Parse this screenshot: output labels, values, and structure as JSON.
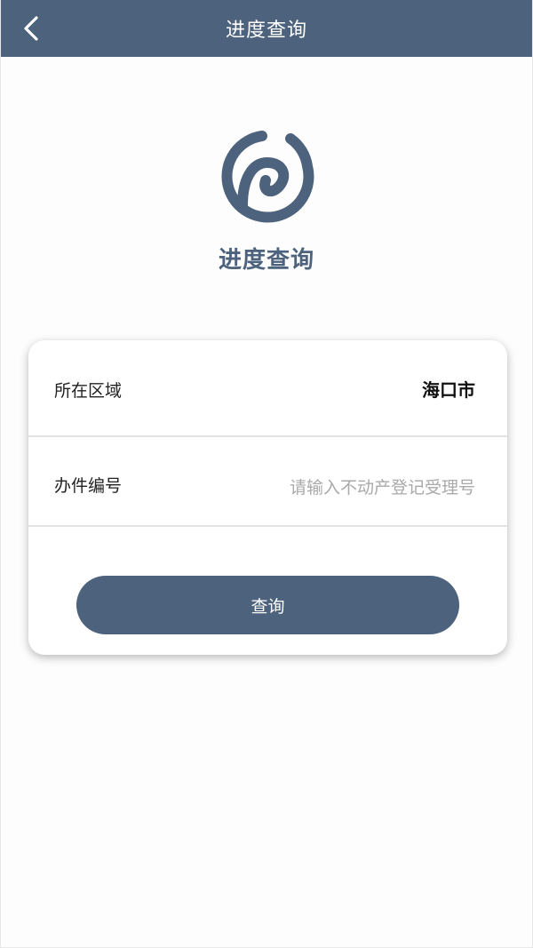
{
  "header": {
    "title": "进度查询",
    "back_icon": "chevron-left-icon"
  },
  "brand": {
    "logo_icon": "brand-logo-icon",
    "title": "进度查询"
  },
  "form": {
    "area": {
      "label": "所在区域",
      "value": "海口市"
    },
    "case_number": {
      "label": "办件编号",
      "value": "",
      "placeholder": "请输入不动产登记受理号"
    },
    "submit_label": "查询"
  },
  "colors": {
    "primary": "#4d627c",
    "background": "#fdfdfd",
    "card": "#ffffff",
    "placeholder": "#a9a9a9"
  }
}
